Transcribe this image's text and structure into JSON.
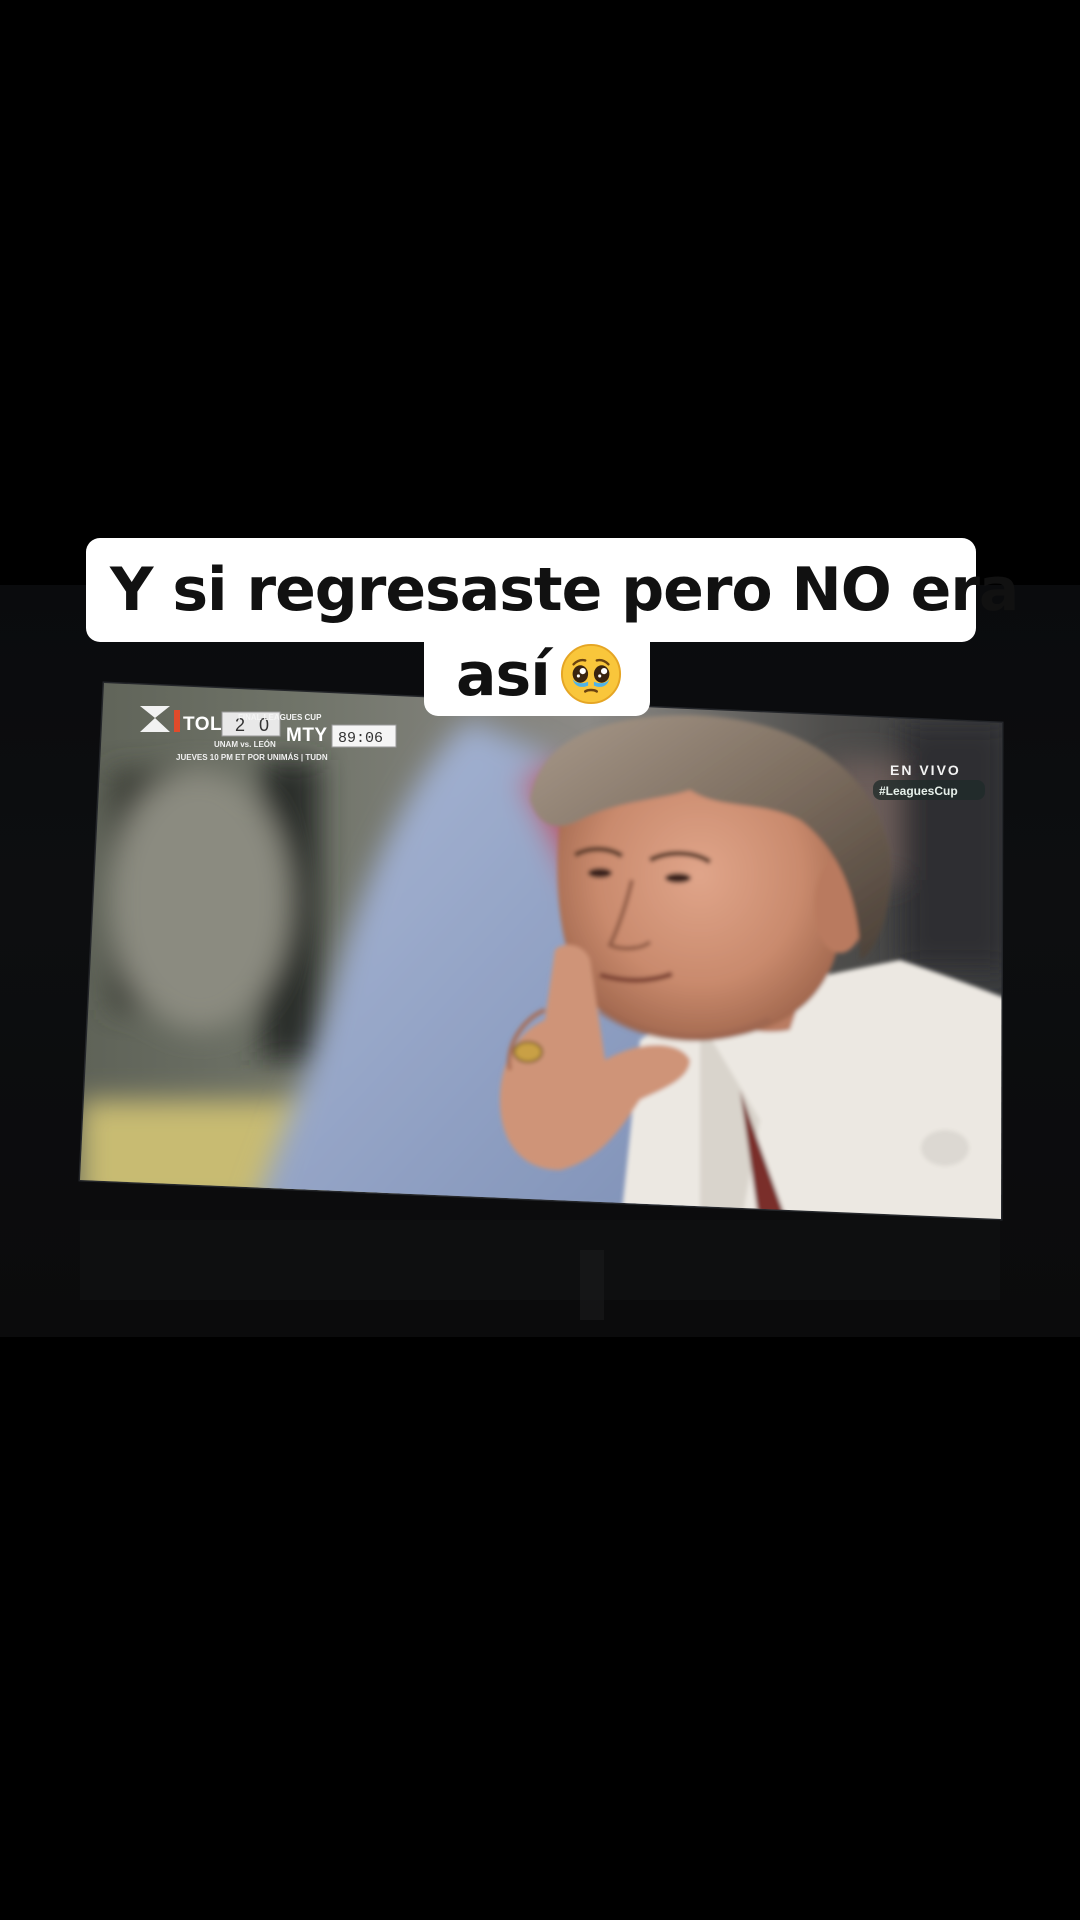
{
  "caption": {
    "line1": "Y si regresaste pero NO era",
    "line2": "así",
    "emoji": "pleading-face-with-tears"
  },
  "broadcast": {
    "competition": "FINAL LEAGUES CUP",
    "home_team": "TOL",
    "home_score": "2",
    "away_score": "0",
    "away_team": "MTY",
    "clock": "89:06",
    "subline1": "UNAM vs. LEÓN",
    "subline2": "JUEVES 10 PM ET POR UNIMÁS | TUDN",
    "live_label": "EN VIVO",
    "hashtag": "#LeaguesCup"
  }
}
